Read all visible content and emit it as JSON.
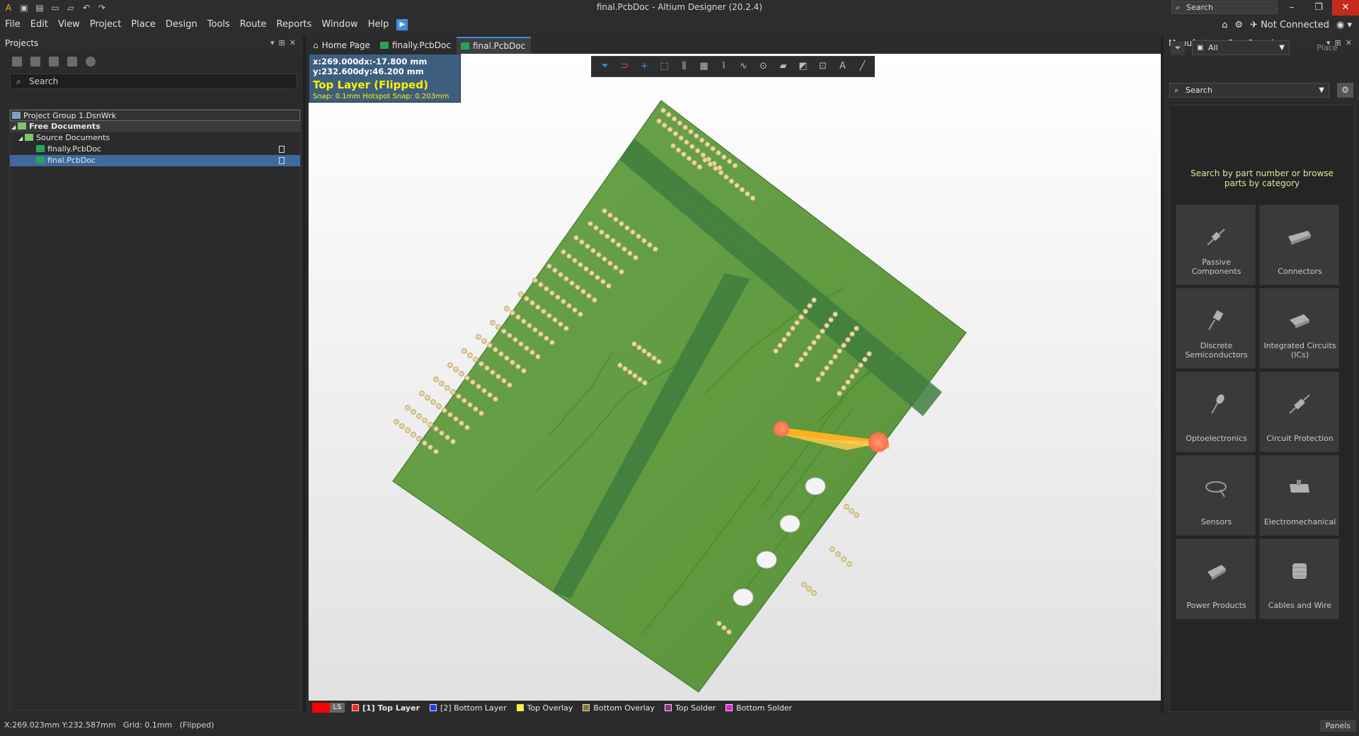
{
  "window": {
    "title": "final.PcbDoc - Altium Designer (20.2.4)",
    "search_placeholder": "Search"
  },
  "quick_access": [
    "app-icon",
    "save-icon",
    "save-all-icon",
    "open-icon",
    "open-project-icon",
    "undo-icon",
    "redo-icon"
  ],
  "menu": [
    "File",
    "Edit",
    "View",
    "Project",
    "Place",
    "Design",
    "Tools",
    "Route",
    "Reports",
    "Window",
    "Help"
  ],
  "menu_right": {
    "connection": "Not Connected"
  },
  "projects_panel": {
    "title": "Projects",
    "search_placeholder": "Search",
    "tree": [
      {
        "label": "Project Group 1.DsnWrk",
        "level": 0,
        "type": "group"
      },
      {
        "label": "Free Documents",
        "level": 1,
        "type": "folder",
        "bold": true
      },
      {
        "label": "Source Documents",
        "level": 2,
        "type": "folder"
      },
      {
        "label": "finally.PcbDoc",
        "level": 3,
        "type": "pcb"
      },
      {
        "label": "final.PcbDoc",
        "level": 3,
        "type": "pcb",
        "selected": true
      }
    ]
  },
  "tabs": [
    {
      "label": "Home Page",
      "icon": "home-icon"
    },
    {
      "label": "finally.PcbDoc",
      "icon": "pcb-doc-icon"
    },
    {
      "label": "final.PcbDoc",
      "icon": "pcb-doc-icon",
      "active": true
    }
  ],
  "hud": {
    "x": "x:269.000",
    "y": "y:232.600",
    "dx": "dx:-17.800 mm",
    "dy": "dy:46.200 mm",
    "layer": "Top Layer (Flipped)",
    "snap": "Snap: 0.1mm Hotspot Snap: 0.203mm"
  },
  "active_bar": [
    "filter-icon",
    "interactive-route-icon",
    "add-icon",
    "select-rect-icon",
    "align-icon",
    "component-icon",
    "diff-pair-icon",
    "tune-icon",
    "via-icon",
    "polygon-icon",
    "dimension-icon",
    "string-icon",
    "text-icon",
    "line-icon"
  ],
  "layers": {
    "ls_label": "LS",
    "items": [
      {
        "label": "[1] Top Layer",
        "color": "#ff2020",
        "bold": true
      },
      {
        "label": "[2] Bottom Layer",
        "color": "#1e3cff"
      },
      {
        "label": "Top Overlay",
        "color": "#ffff00"
      },
      {
        "label": "Bottom Overlay",
        "color": "#8a7a2a"
      },
      {
        "label": "Top Solder",
        "color": "#9b2b8f"
      },
      {
        "label": "Bottom Solder",
        "color": "#e020e0"
      }
    ]
  },
  "mps": {
    "title": "Manufacturer Part Search",
    "filter_value": "All",
    "place_label": "Place",
    "search_placeholder": "Search",
    "hint": "Search by part number or browse parts by category",
    "categories": [
      {
        "label": "Passive Components",
        "icon": "resistor-icon"
      },
      {
        "label": "Connectors",
        "icon": "connector-icon"
      },
      {
        "label": "Discrete Semiconductors",
        "icon": "transistor-icon"
      },
      {
        "label": "Integrated Circuits (ICs)",
        "icon": "ic-chip-icon"
      },
      {
        "label": "Optoelectronics",
        "icon": "led-icon"
      },
      {
        "label": "Circuit Protection",
        "icon": "fuse-icon"
      },
      {
        "label": "Sensors",
        "icon": "sensor-icon"
      },
      {
        "label": "Electromechanical",
        "icon": "switch-icon"
      },
      {
        "label": "Power Products",
        "icon": "power-icon"
      },
      {
        "label": "Cables and Wire",
        "icon": "cable-icon"
      }
    ]
  },
  "status": {
    "coords": "X:269.023mm Y:232.587mm",
    "grid": "Grid: 0.1mm",
    "mode": "(Flipped)",
    "panels_label": "Panels"
  }
}
